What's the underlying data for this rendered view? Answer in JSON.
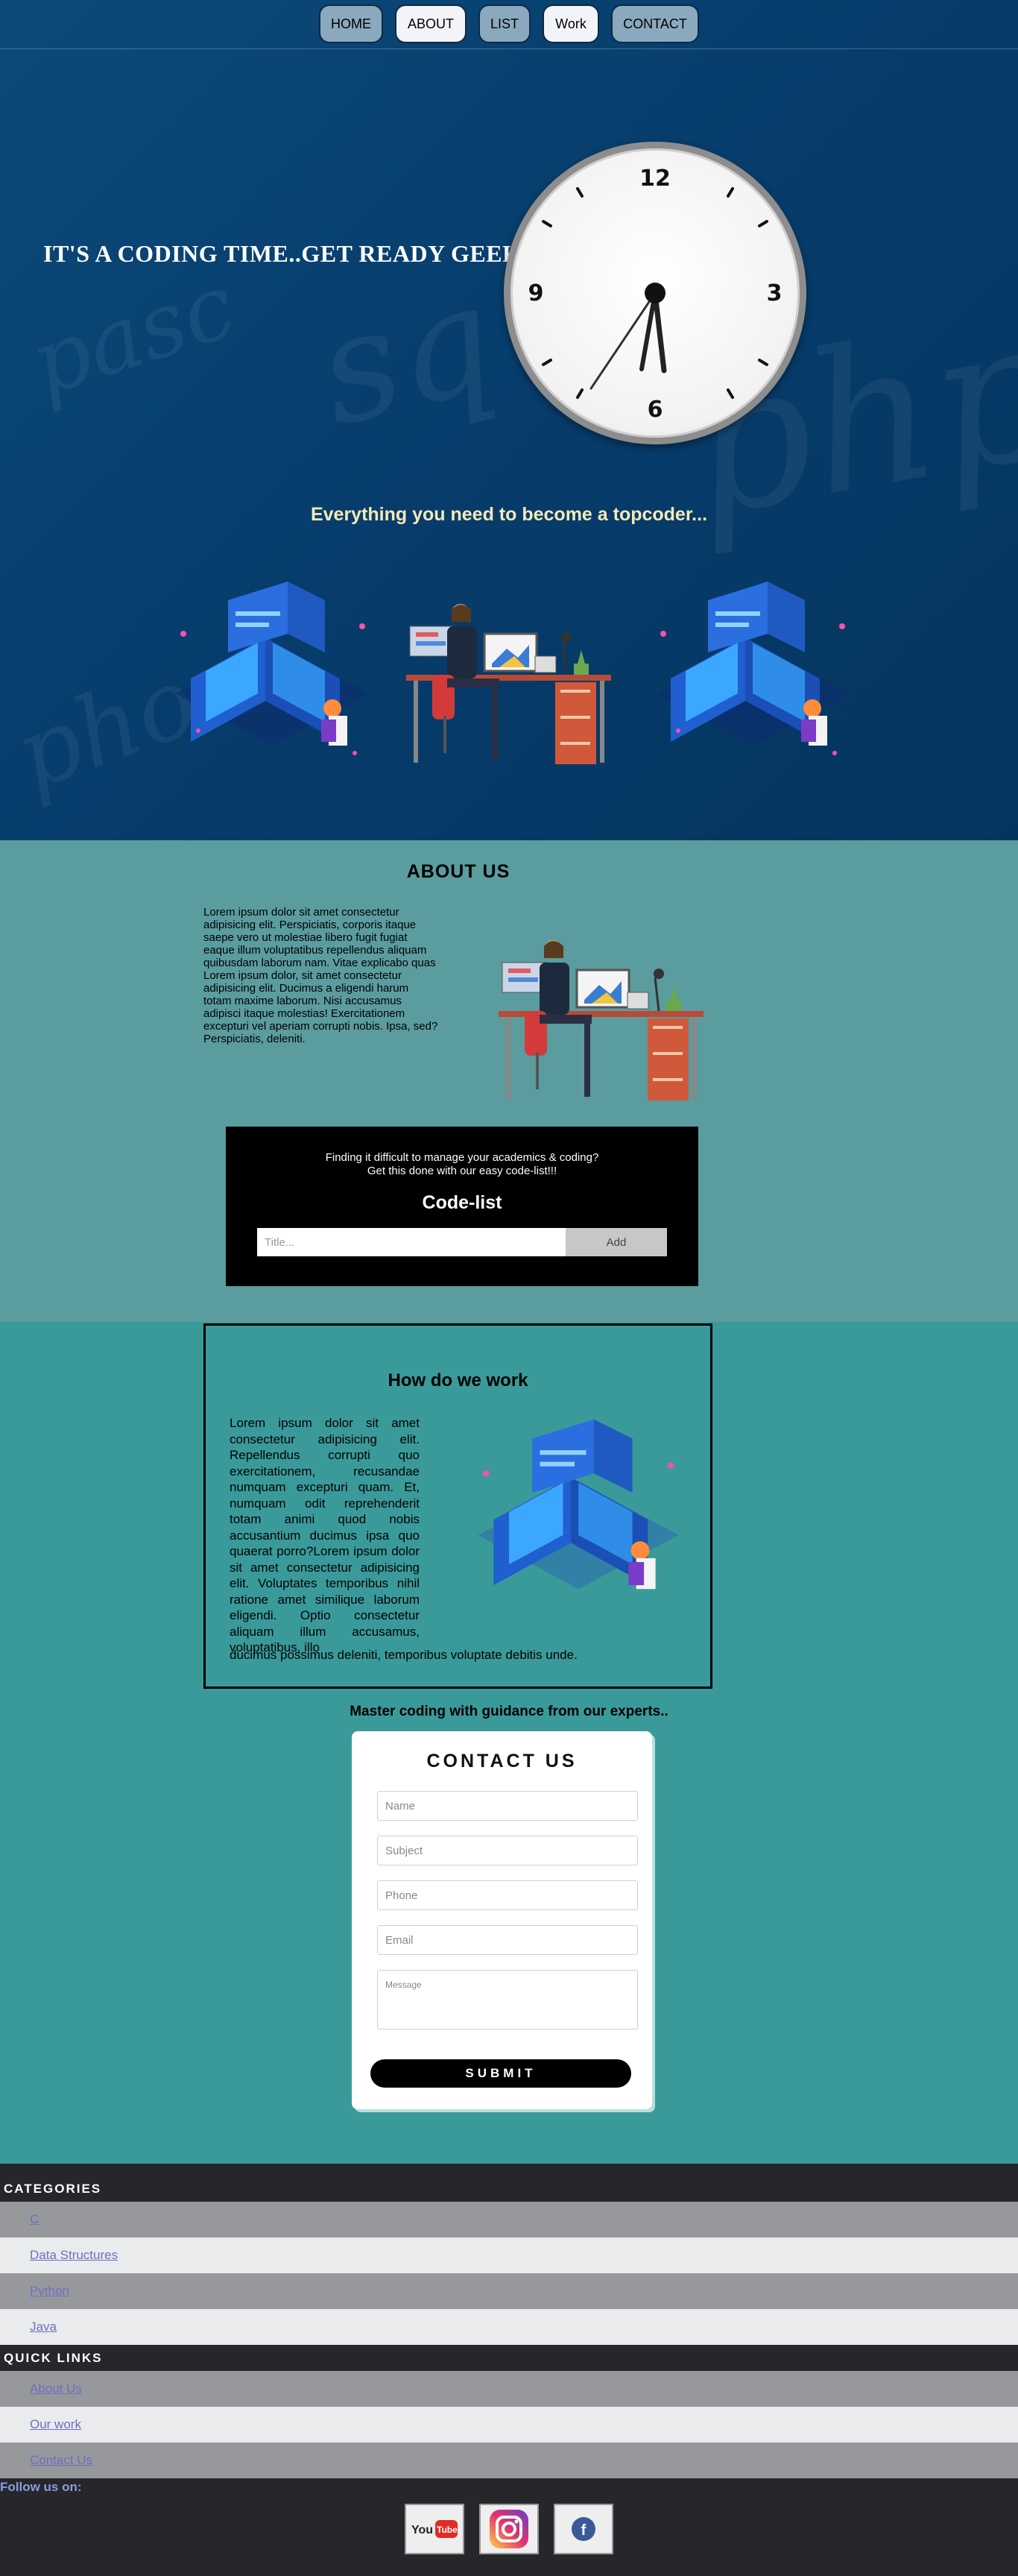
{
  "nav": {
    "items": [
      {
        "label": "HOME"
      },
      {
        "label": "ABOUT"
      },
      {
        "label": "LIST"
      },
      {
        "label": "Work"
      },
      {
        "label": "CONTACT"
      }
    ]
  },
  "hero": {
    "title": "IT'S A CODING TIME..GET READY GEEKS !",
    "tagline": "Everything you need to become a topcoder...",
    "clock_numbers": [
      "12",
      "3",
      "6",
      "9"
    ],
    "background_words": [
      "pascal",
      "sql",
      "php",
      "python"
    ]
  },
  "about": {
    "title": "ABOUT US",
    "text": "Lorem ipsum dolor sit amet consectetur adipisicing elit. Perspiciatis, corporis itaque saepe vero ut molestiae libero fugit fugiat eaque illum voluptatibus repellendus aliquam quibusdam laborum nam. Vitae explicabo quas Lorem ipsum dolor, sit amet consectetur adipisicing elit. Ducimus a eligendi harum totam maxime laborum. Nisi accusamus adipisci itaque molestias! Exercitationem excepturi vel aperiam corrupti nobis. Ipsa, sed? Perspiciatis, deleniti."
  },
  "codelist": {
    "line1": "Finding it difficult to manage your academics & coding?",
    "line2": "Get this done with our easy code-list!!!",
    "title": "Code-list",
    "placeholder": "Title...",
    "add_label": "Add"
  },
  "how": {
    "title": "How do we work",
    "text": "Lorem ipsum dolor sit amet consectetur adipisicing elit. Repellendus corrupti quo exercitationem, recusandae numquam excepturi quam. Et, numquam odit reprehenderit totam animi quod nobis accusantium ducimus ipsa quo quaerat porro?Lorem ipsum dolor sit amet consectetur adipisicing elit. Voluptates temporibus nihil ratione amet similique laborum eligendi. Optio consectetur aliquam illum accusamus, voluptatibus, illo",
    "tail": "ducimus possimus deleniti, temporibus voluptate debitis unde."
  },
  "master": "Master coding with guidance from our experts..",
  "contact": {
    "title": "CONTACT US",
    "name": "Name",
    "subject": "Subject",
    "phone": "Phone",
    "email": "Email",
    "message": "Message",
    "submit": "SUBMIT"
  },
  "footer": {
    "categories_title": "CATEGORIES",
    "categories": [
      "C",
      "Data Structures",
      "Python",
      "Java"
    ],
    "quick_title": "QUICK LINKS",
    "quick": [
      "About Us",
      "Our work",
      "Contact Us"
    ],
    "follow": "Follow us on:",
    "social": [
      "youtube-icon",
      "instagram-icon",
      "facebook-icon"
    ]
  },
  "colors": {
    "hero_bg": "#073c6b",
    "about_bg": "#5b9c9e",
    "page_bg": "#3a9a9a",
    "footer_bg": "#26272b",
    "link": "#6d6fc0"
  }
}
